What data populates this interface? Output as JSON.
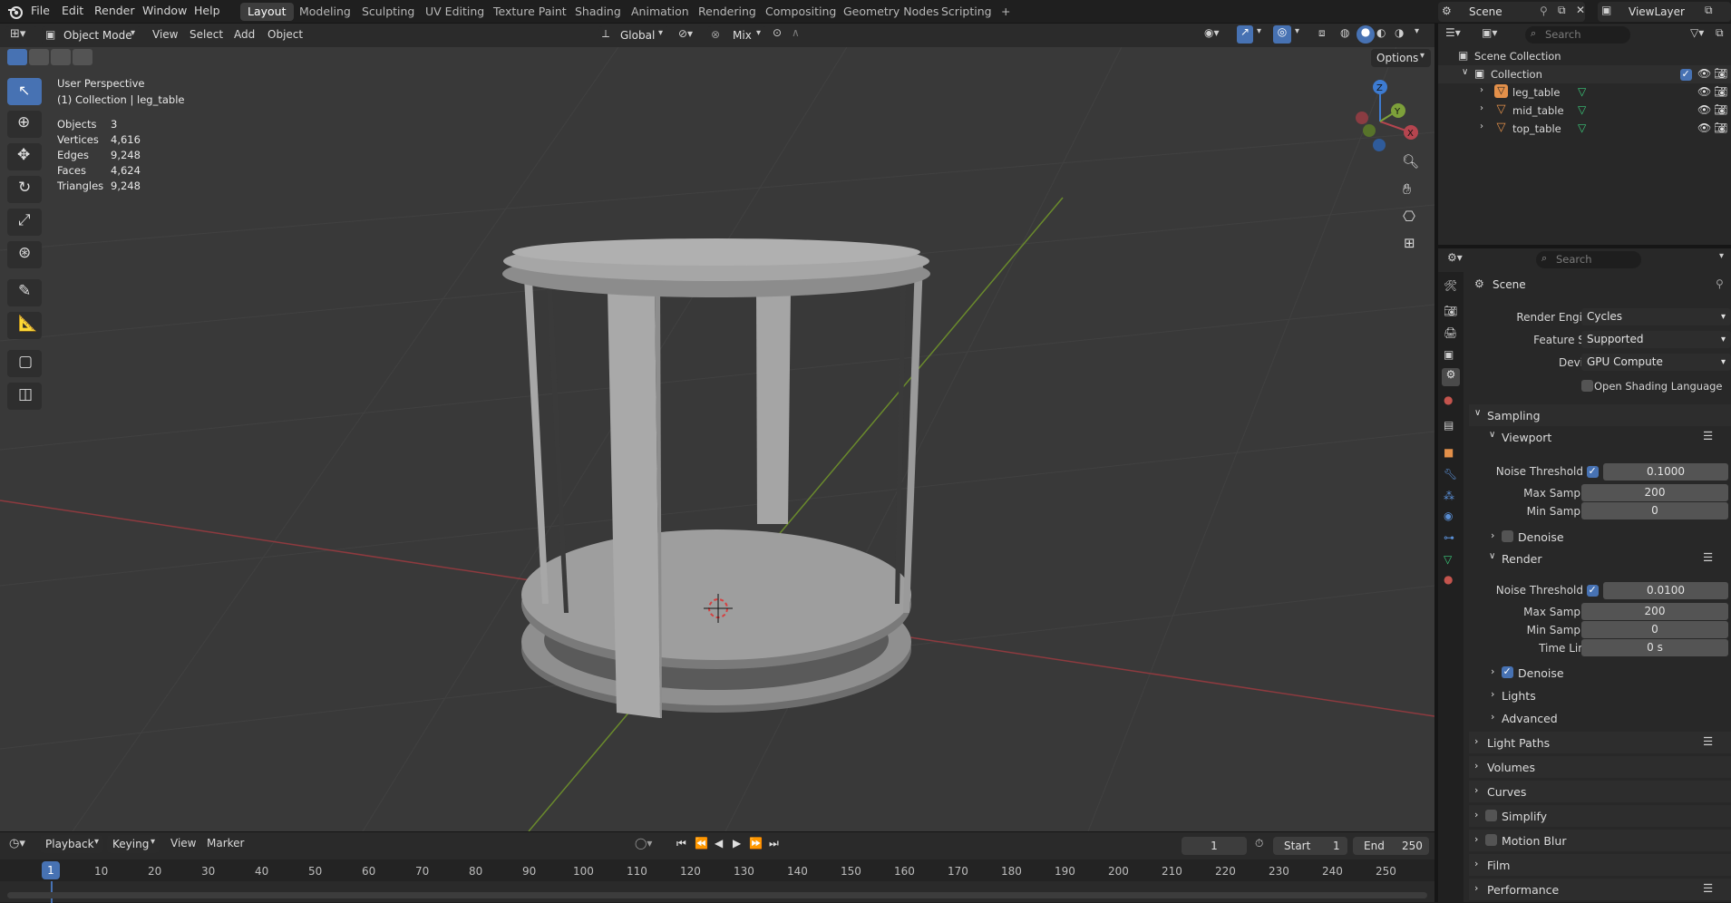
{
  "menu": {
    "items": [
      "File",
      "Edit",
      "Render",
      "Window",
      "Help"
    ],
    "workspaces": [
      "Layout",
      "Modeling",
      "Sculpting",
      "UV Editing",
      "Texture Paint",
      "Shading",
      "Animation",
      "Rendering",
      "Compositing",
      "Geometry Nodes",
      "Scripting"
    ],
    "active_workspace": "Layout",
    "add_tab": "+",
    "scene_name": "Scene",
    "view_layer": "ViewLayer"
  },
  "viewport_header": {
    "mode": "Object Mode",
    "menus": [
      "View",
      "Select",
      "Add",
      "Object"
    ],
    "orientation": "Global",
    "snap": "Mix",
    "options": "Options"
  },
  "viewport_info": {
    "perspective": "User Perspective",
    "collection": "(1) Collection | leg_table"
  },
  "stats": [
    {
      "label": "Objects",
      "value": "3"
    },
    {
      "label": "Vertices",
      "value": "4,616"
    },
    {
      "label": "Edges",
      "value": "9,248"
    },
    {
      "label": "Faces",
      "value": "4,624"
    },
    {
      "label": "Triangles",
      "value": "9,248"
    }
  ],
  "gizmo": {
    "x": "X",
    "y": "Y",
    "z": "Z"
  },
  "timeline": {
    "menus": [
      "Playback",
      "Keying",
      "View",
      "Marker"
    ],
    "current_frame": "1",
    "start_label": "Start",
    "start": "1",
    "end_label": "End",
    "end": "250",
    "ticks": [
      "1",
      "10",
      "20",
      "30",
      "40",
      "50",
      "60",
      "70",
      "80",
      "90",
      "100",
      "110",
      "120",
      "130",
      "140",
      "150",
      "160",
      "170",
      "180",
      "190",
      "200",
      "210",
      "220",
      "230",
      "240",
      "250"
    ]
  },
  "outliner": {
    "search_placeholder": "Search",
    "scene_collection": "Scene Collection",
    "collection": "Collection",
    "objects": [
      "leg_table",
      "mid_table",
      "top_table"
    ]
  },
  "properties": {
    "search_placeholder": "Search",
    "context": "Scene",
    "render_engine_label": "Render Engine",
    "render_engine": "Cycles",
    "feature_set_label": "Feature Set",
    "feature_set": "Supported",
    "device_label": "Device",
    "device": "GPU Compute",
    "osl_label": "Open Shading Language",
    "sampling": "Sampling",
    "viewport": "Viewport",
    "vp_noise_label": "Noise Threshold",
    "vp_noise": "0.1000",
    "vp_max_label": "Max Samples",
    "vp_max": "200",
    "vp_min_label": "Min Samples",
    "vp_min": "0",
    "vp_denoise": "Denoise",
    "render": "Render",
    "r_noise_label": "Noise Threshold",
    "r_noise": "0.0100",
    "r_max_label": "Max Samples",
    "r_max": "200",
    "r_min_label": "Min Samples",
    "r_min": "0",
    "r_time_label": "Time Limit",
    "r_time": "0 s",
    "r_denoise": "Denoise",
    "lights": "Lights",
    "advanced": "Advanced",
    "panels": [
      "Light Paths",
      "Volumes",
      "Curves",
      "Simplify",
      "Motion Blur",
      "Film",
      "Performance"
    ]
  },
  "colors": {
    "accent": "#4772b3",
    "x_axis": "#b5454f",
    "y_axis": "#7da03a",
    "z_axis": "#3d7bd1",
    "mesh_icon": "#3ac97a",
    "object_icon": "#e3904a"
  }
}
